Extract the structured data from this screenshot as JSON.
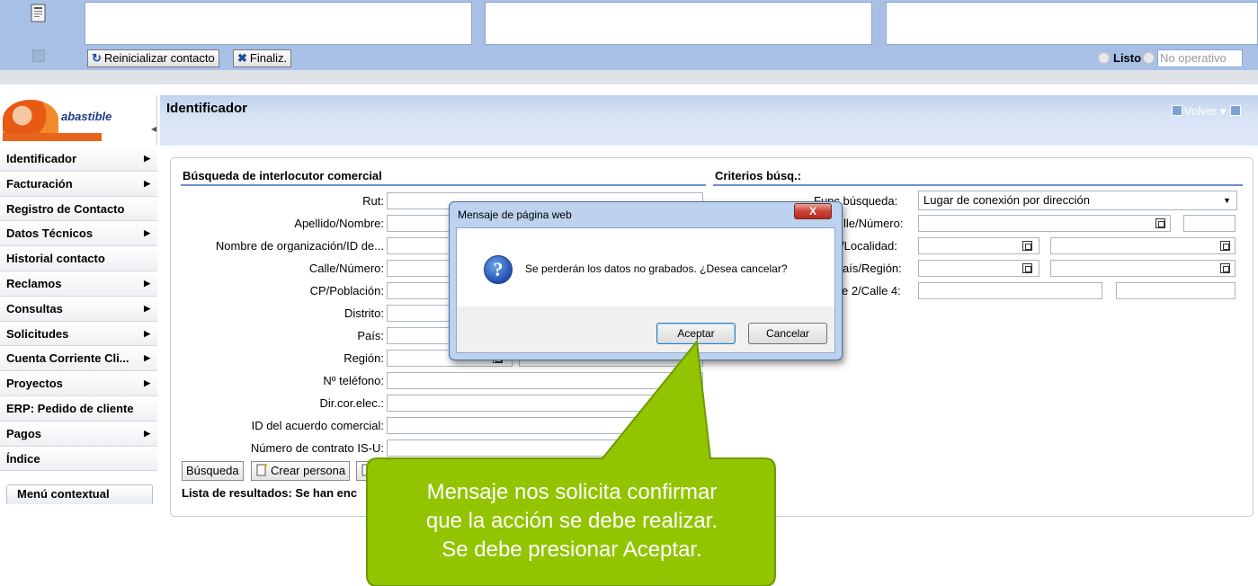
{
  "toolbar": {
    "reset_label": "Reinicializar contacto",
    "finish_label": "Finaliz.",
    "status_ready": "Listo",
    "status_not_operational": "No operativo"
  },
  "logo": {
    "brand": "abastible"
  },
  "sidebar": {
    "items": [
      {
        "label": "Identificador",
        "arrow": true
      },
      {
        "label": "Facturación",
        "arrow": true
      },
      {
        "label": "Registro de Contacto",
        "arrow": false
      },
      {
        "label": "Datos Técnicos",
        "arrow": true
      },
      {
        "label": "Historial contacto",
        "arrow": false
      },
      {
        "label": "Reclamos",
        "arrow": true
      },
      {
        "label": "Consultas",
        "arrow": true
      },
      {
        "label": "Solicitudes",
        "arrow": true
      },
      {
        "label": "Cuenta Corriente Cli...",
        "arrow": true
      },
      {
        "label": "Proyectos",
        "arrow": true
      },
      {
        "label": "ERP: Pedido de cliente",
        "arrow": false
      },
      {
        "label": "Pagos",
        "arrow": true
      },
      {
        "label": "Índice",
        "arrow": false
      }
    ],
    "context_menu_label": "Menú contextual"
  },
  "header": {
    "title": "Identificador",
    "back_label": "Volver"
  },
  "search_form": {
    "title": "Búsqueda de interlocutor comercial",
    "fields": [
      {
        "label": "Rut:"
      },
      {
        "label": "Apellido/Nombre:"
      },
      {
        "label": "Nombre de organización/ID de..."
      },
      {
        "label": "Calle/Número:"
      },
      {
        "label": "CP/Población:"
      },
      {
        "label": "Distrito:"
      },
      {
        "label": "País:"
      },
      {
        "label": "Región:"
      },
      {
        "label": "Nº teléfono:"
      },
      {
        "label": "Dir.cor.elec.:"
      },
      {
        "label": "ID del acuerdo comercial:"
      },
      {
        "label": "Número de contrato IS-U:"
      }
    ],
    "search_button": "Búsqueda",
    "create_person_button": "Crear persona",
    "results_text": "Lista de resultados: Se han enc"
  },
  "criteria": {
    "title": "Criterios búsq.:",
    "labels": {
      "search_type": "Func.búsqueda:",
      "street_number": "lle/Número:",
      "locality": "/Localidad:",
      "country_region": "aís/Región:",
      "street24": "e 2/Calle 4:"
    },
    "search_type_value": "Lugar de conexión por dirección"
  },
  "dialog": {
    "title": "Mensaje de página web",
    "close_symbol": "X",
    "message": "Se perderán los datos no grabados. ¿Desea cancelar?",
    "ok_label": "Aceptar",
    "cancel_label": "Cancelar"
  },
  "callout": {
    "line1": "Mensaje nos solicita confirmar",
    "line2": "que la acción se debe realizar.",
    "line3": "Se debe presionar Aceptar.",
    "color": "#92c400"
  }
}
